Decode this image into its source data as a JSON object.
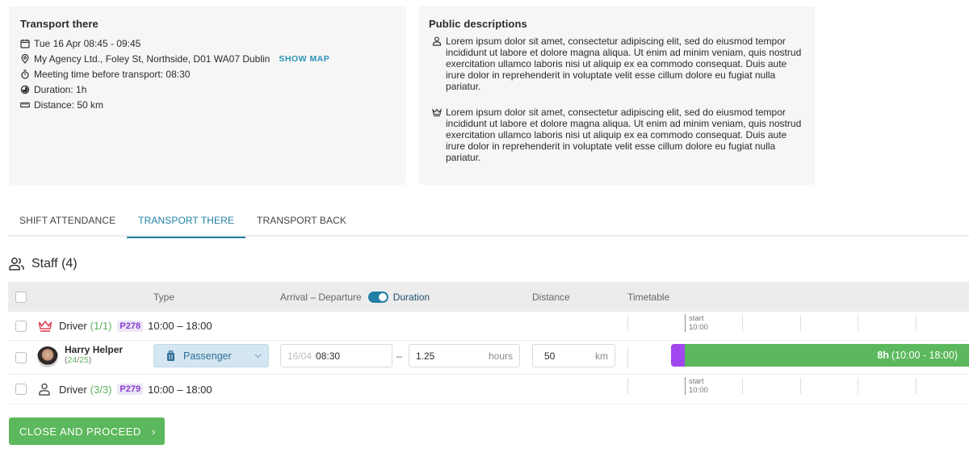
{
  "transport_card": {
    "title": "Transport there",
    "date": "Tue 16 Apr 08:45 - 09:45",
    "address": "My Agency Ltd., Foley St, Northside, D01 WA07 Dublin",
    "show_map_label": "SHOW MAP",
    "meeting_time": "Meeting time before transport: 08:30",
    "duration": "Duration: 1h",
    "distance": "Distance: 50 km"
  },
  "public_card": {
    "title": "Public descriptions",
    "descriptions": [
      {
        "icon": "person-icon",
        "text": "Lorem ipsum dolor sit amet, consectetur adipiscing elit, sed do eiusmod tempor incididunt ut labore et dolore magna aliqua. Ut enim ad minim veniam, quis nostrud exercitation ullamco laboris nisi ut aliquip ex ea commodo consequat. Duis aute irure dolor in reprehenderit in voluptate velit esse cillum dolore eu fugiat nulla pariatur."
      },
      {
        "icon": "crown-icon",
        "text": "Lorem ipsum dolor sit amet, consectetur adipiscing elit, sed do eiusmod tempor incididunt ut labore et dolore magna aliqua. Ut enim ad minim veniam, quis nostrud exercitation ullamco laboris nisi ut aliquip ex ea commodo consequat. Duis aute irure dolor in reprehenderit in voluptate velit esse cillum dolore eu fugiat nulla pariatur."
      }
    ]
  },
  "tabs": [
    {
      "label": "SHIFT ATTENDANCE",
      "active": false
    },
    {
      "label": "TRANSPORT THERE",
      "active": true
    },
    {
      "label": "TRANSPORT BACK",
      "active": false
    }
  ],
  "staff": {
    "title": "Staff (4)",
    "columns": {
      "type": "Type",
      "arrival_departure": "Arrival – Departure",
      "duration": "Duration",
      "distance": "Distance",
      "timetable": "Timetable"
    },
    "duration_toggle_on": true,
    "groups": [
      {
        "role": "Driver",
        "count": "(1/1)",
        "badge": "P278",
        "time": "10:00 – 18:00",
        "icon": "crown-icon",
        "timetable_start_label": "start",
        "timetable_start_time": "10:00"
      },
      {
        "role": "Driver",
        "count": "(3/3)",
        "badge": "P279",
        "time": "10:00 – 18:00",
        "icon": "person-icon",
        "timetable_start_label": "start",
        "timetable_start_time": "10:00"
      }
    ],
    "person": {
      "name": "Harry Helper",
      "count_a": "24",
      "count_b": "25",
      "type": "Passenger",
      "date": "16/04",
      "time": "08:30",
      "dash": "–",
      "duration_value": "1.25",
      "duration_unit": "hours",
      "distance_value": "50",
      "distance_unit": "km",
      "bar_hours": "8h",
      "bar_range": "(10:00 - 18:00)"
    }
  },
  "colors": {
    "accent": "#1f7fa5",
    "success": "#5cb85c",
    "badge_purple": "#8a3fd1",
    "crown_red": "#e0455a"
  },
  "actions": {
    "close_proceed": "CLOSE AND PROCEED",
    "close_proceed_chevron": "›"
  }
}
